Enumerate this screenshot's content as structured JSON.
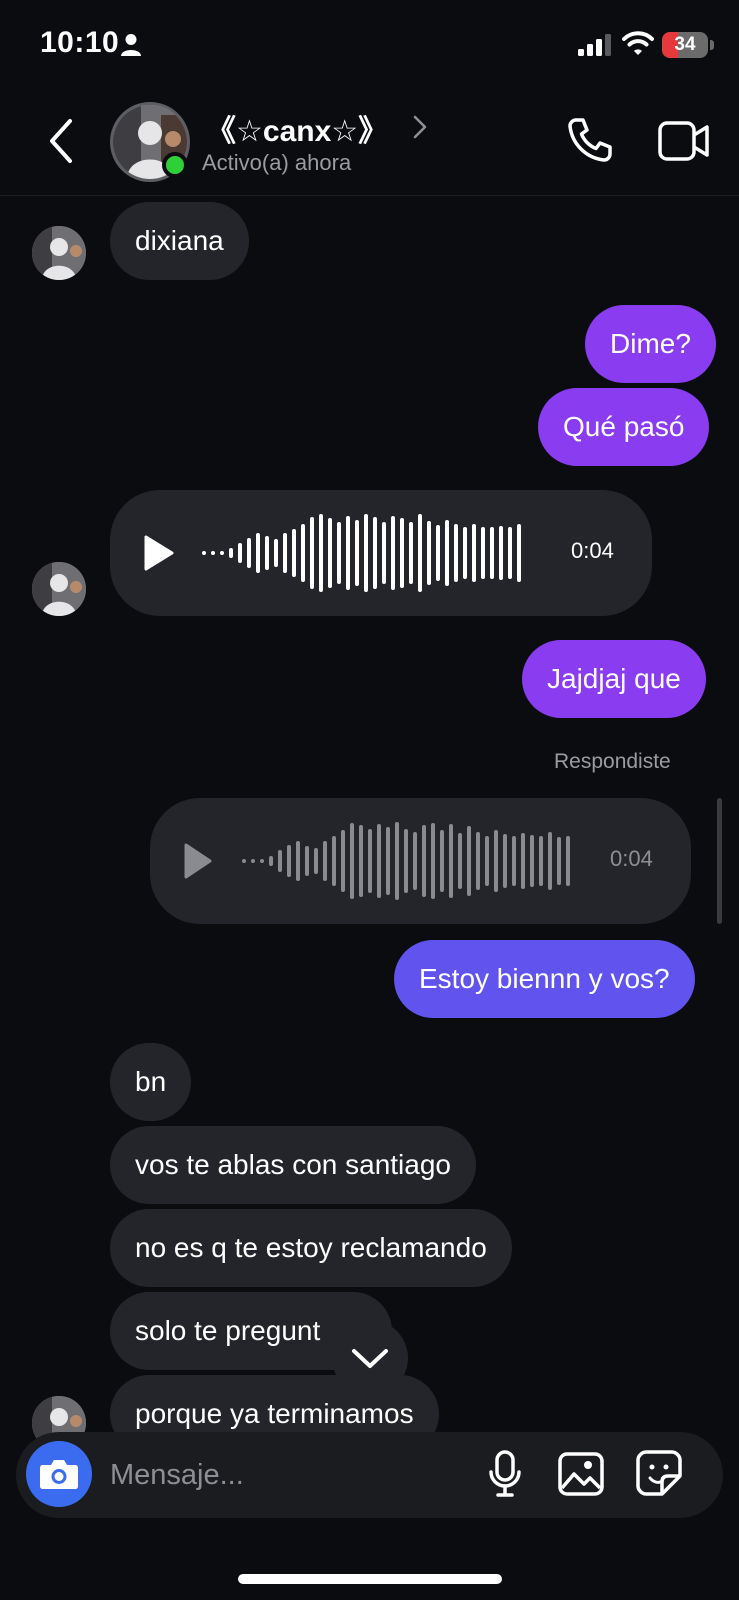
{
  "status_bar": {
    "time": "10:10",
    "battery_level": "34",
    "battery_fraction": 0.34
  },
  "header": {
    "contact_name": "《☆canx☆》",
    "status": "Activo(a) ahora"
  },
  "messages": [
    {
      "side": "incoming",
      "type": "text",
      "text": "dixiana"
    },
    {
      "side": "outgoing",
      "type": "text",
      "text": "Dime?"
    },
    {
      "side": "outgoing",
      "type": "text",
      "text": "Qué pasó"
    },
    {
      "side": "incoming",
      "type": "voice",
      "duration": "0:04"
    },
    {
      "side": "outgoing",
      "type": "text",
      "text": "Jajdjaj que"
    },
    {
      "side": "outgoing",
      "type": "reply_label",
      "text": "Respondiste"
    },
    {
      "side": "outgoing",
      "type": "voice",
      "duration": "0:04"
    },
    {
      "side": "outgoing",
      "type": "text",
      "text": "Estoy biennn y vos?"
    },
    {
      "side": "incoming",
      "type": "text",
      "text": "bn"
    },
    {
      "side": "incoming",
      "type": "text",
      "text": "vos te ablas con santiago"
    },
    {
      "side": "incoming",
      "type": "text",
      "text": "no es q te estoy reclamando"
    },
    {
      "side": "incoming",
      "type": "text",
      "text": "solo te pregunt"
    },
    {
      "side": "incoming",
      "type": "text",
      "text": "porque ya terminamos"
    }
  ],
  "composer": {
    "placeholder": "Mensaje..."
  },
  "colors": {
    "background": "#0b0c10",
    "incoming_bubble": "#24252a",
    "outgoing_bubble": "#8a3cf0",
    "outgoing_bubble_late": "#6153ee",
    "online": "#2fcf37",
    "camera_button": "#3b6cf0"
  },
  "icons": [
    "person-icon",
    "signal-icon",
    "wifi-icon",
    "back-icon",
    "chevron-right-icon",
    "phone-icon",
    "video-icon",
    "play-icon",
    "chevron-down-icon",
    "camera-icon",
    "mic-icon",
    "image-icon",
    "sticker-icon"
  ]
}
